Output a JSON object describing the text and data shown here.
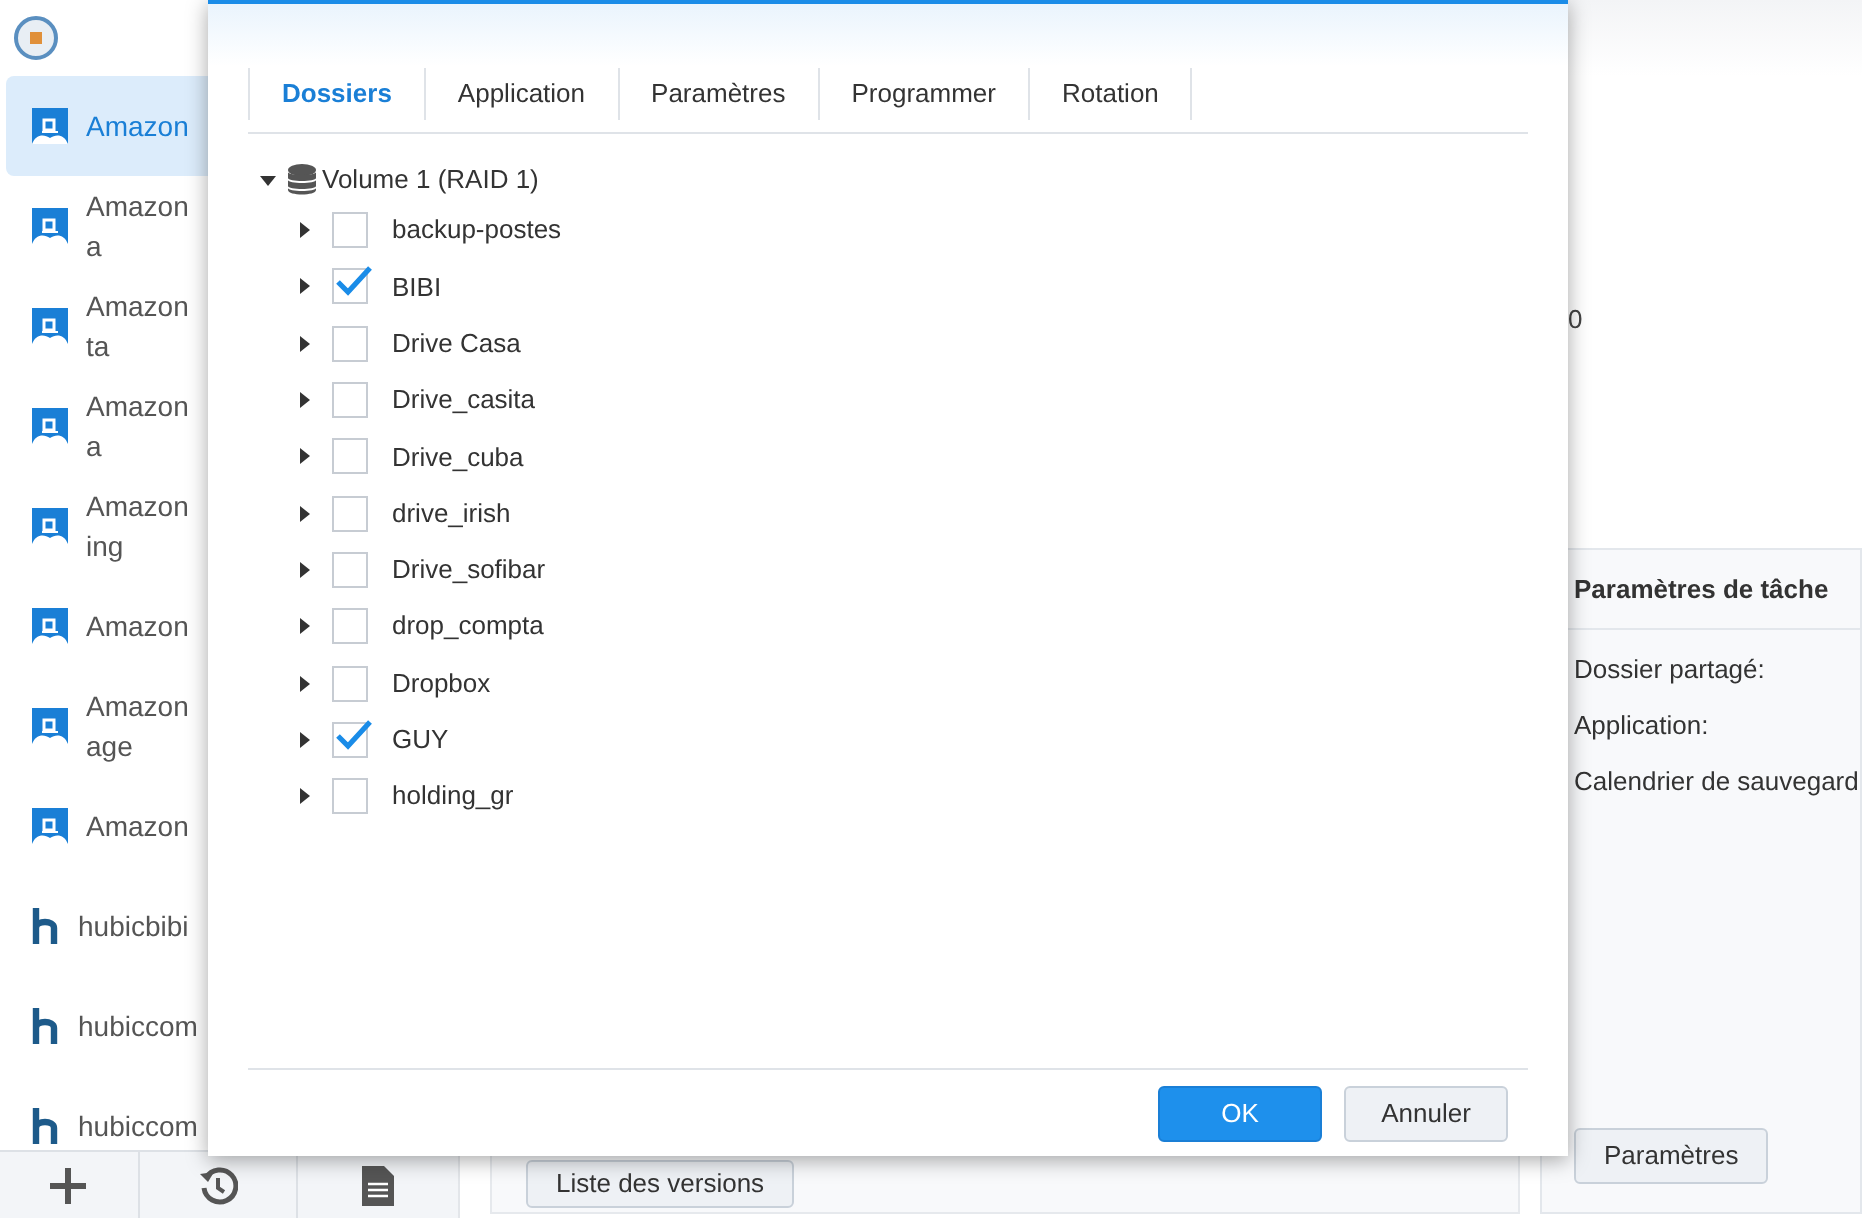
{
  "sidebar": {
    "items": [
      {
        "kind": "amazon",
        "lines": [
          "Amazon"
        ],
        "selected": true
      },
      {
        "kind": "amazon",
        "lines": [
          "Amazon",
          "a"
        ],
        "selected": false
      },
      {
        "kind": "amazon",
        "lines": [
          "Amazon",
          "ta"
        ],
        "selected": false
      },
      {
        "kind": "amazon",
        "lines": [
          "Amazon",
          "a"
        ],
        "selected": false
      },
      {
        "kind": "amazon",
        "lines": [
          "Amazon",
          "ing"
        ],
        "selected": false
      },
      {
        "kind": "amazon",
        "lines": [
          "Amazon"
        ],
        "selected": false
      },
      {
        "kind": "amazon",
        "lines": [
          "Amazon",
          "age"
        ],
        "selected": false
      },
      {
        "kind": "amazon",
        "lines": [
          "Amazon"
        ],
        "selected": false
      },
      {
        "kind": "hubic",
        "lines": [
          "hubicbibi"
        ],
        "selected": false
      },
      {
        "kind": "hubic",
        "lines": [
          "hubiccom"
        ],
        "selected": false
      },
      {
        "kind": "hubic",
        "lines": [
          "hubiccom"
        ],
        "selected": false
      }
    ]
  },
  "main": {
    "fragment": "0",
    "versions_button": "Liste des versions",
    "task_panel": {
      "title": "Paramètres de tâche",
      "labels": [
        "Dossier partagé:",
        "Application:",
        "Calendrier de sauvegard"
      ],
      "button": "Paramètres"
    }
  },
  "dialog": {
    "tabs": [
      {
        "label": "Dossiers",
        "selected": true
      },
      {
        "label": "Application",
        "selected": false
      },
      {
        "label": "Paramètres",
        "selected": false
      },
      {
        "label": "Programmer",
        "selected": false
      },
      {
        "label": "Rotation",
        "selected": false
      }
    ],
    "tree": {
      "label": "Volume 1 (RAID 1)",
      "expanded": true,
      "children": [
        {
          "label": "backup-postes",
          "checked": false,
          "expanded": false
        },
        {
          "label": "BIBI",
          "checked": true,
          "expanded": false
        },
        {
          "label": "Drive Casa",
          "checked": false,
          "expanded": false
        },
        {
          "label": "Drive_casita",
          "checked": false,
          "expanded": false
        },
        {
          "label": "Drive_cuba",
          "checked": false,
          "expanded": false
        },
        {
          "label": "drive_irish",
          "checked": false,
          "expanded": false
        },
        {
          "label": "Drive_sofibar",
          "checked": false,
          "expanded": false
        },
        {
          "label": "drop_compta",
          "checked": false,
          "expanded": false
        },
        {
          "label": "Dropbox",
          "checked": false,
          "expanded": false
        },
        {
          "label": "GUY",
          "checked": true,
          "expanded": false
        },
        {
          "label": "holding_gr",
          "checked": false,
          "expanded": false
        }
      ]
    },
    "buttons": [
      {
        "label": "OK",
        "kind": "primary"
      },
      {
        "label": "Annuler",
        "kind": "secondary"
      }
    ]
  }
}
